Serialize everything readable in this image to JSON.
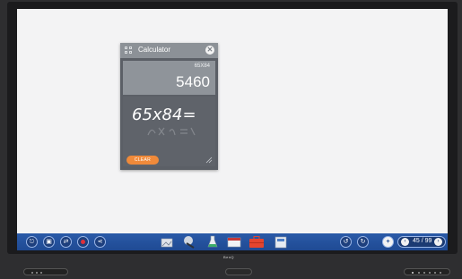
{
  "calculator": {
    "title": "Calculator",
    "expression": "65X84",
    "result": "5460",
    "handwriting": "65x84=",
    "clear_label": "CLEAR"
  },
  "taskbar": {
    "page_indicator": "45 / 99"
  },
  "monitor": {
    "brand": "BenQ"
  },
  "colors": {
    "taskbar_blue": "#2a5aa8",
    "clear_orange": "#f08a3a",
    "calc_panel": "#5b5f66"
  }
}
